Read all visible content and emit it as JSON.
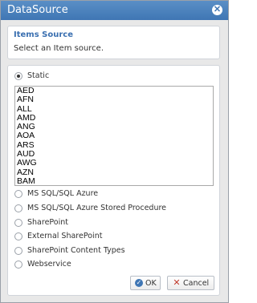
{
  "window": {
    "title": "DataSource"
  },
  "info": {
    "title": "Items Source",
    "description": "Select an Item source."
  },
  "options": {
    "static": "Static",
    "mssql": "MS SQL/SQL Azure",
    "mssql_sp": "MS SQL/SQL Azure Stored Procedure",
    "sharepoint": "SharePoint",
    "external_sharepoint": "External SharePoint",
    "sharepoint_ct": "SharePoint Content Types",
    "webservice": "Webservice"
  },
  "list_items": [
    "AED",
    "AFN",
    "ALL",
    "AMD",
    "ANG",
    "AOA",
    "ARS",
    "AUD",
    "AWG",
    "AZN",
    "BAM"
  ],
  "buttons": {
    "ok": "OK",
    "cancel": "Cancel"
  },
  "colors": {
    "titlebar": "#3f76b4",
    "accent": "#3a6fb0"
  }
}
